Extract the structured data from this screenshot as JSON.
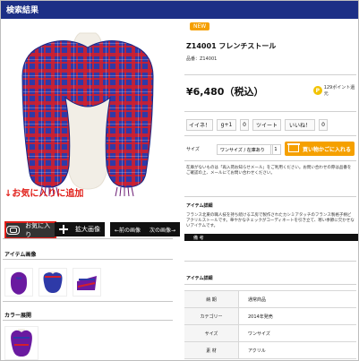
{
  "header": {
    "title": "検索結果"
  },
  "left": {
    "overlay_note": "↓お気に入りに追加",
    "favorite_label": "お気に入り",
    "zoom_label": "拡大画像",
    "prev_label": "←前の画像",
    "next_label": "次の画像→",
    "item_images_title": "アイテム画像",
    "color_variations_title": "カラー展開"
  },
  "right": {
    "badge": "NEW",
    "product_title": "Z14001 フレンチストール",
    "product_code": "品番：Z14001",
    "price": "¥6,480（税込）",
    "points_text": "129ポイント還元",
    "social": {
      "like": "イイネ！",
      "gplus": "g+1",
      "gplus_count": "0",
      "tweet": "ツイート",
      "fb_like": "いいね！",
      "fb_count": "0"
    },
    "size_label": "サイズ",
    "size_select_value": "ワンサイズ / 在庫あり",
    "quantity": "1",
    "add_to_cart": "買い物かごに入れる",
    "note": "在庫がないものは「再入荷お知らせメール」をご利用ください。お問い合わせの際は品番をご確認の上、メールにてお問い合わせください。",
    "item_detail_title": "アイテム詳細",
    "item_detail_text": "フランス北東の職人技を持ち続ける工房で製作されたカシミアタッチのフランス製格子柄ビアクリルストールです。華やかなチェックがコーディネートを引き立て、寒い季節に欠かせないアイテムです。",
    "remarks_bar": "備 考",
    "item_detail_title_2": "アイテム詳細",
    "spec": [
      {
        "key": "納 期",
        "value": "通常商品"
      },
      {
        "key": "カテゴリー",
        "value": "2014年発売"
      },
      {
        "key": "サイズ",
        "value": "ワンサイズ"
      },
      {
        "key": "素 材",
        "value": "アクリル"
      }
    ]
  },
  "colors": {
    "primary_blue": "#1c2f86",
    "accent_red": "#e11f19",
    "accent_orange": "#f5a000",
    "scarf_blue": "#2e3aa8",
    "scarf_red": "#d31f2c"
  }
}
